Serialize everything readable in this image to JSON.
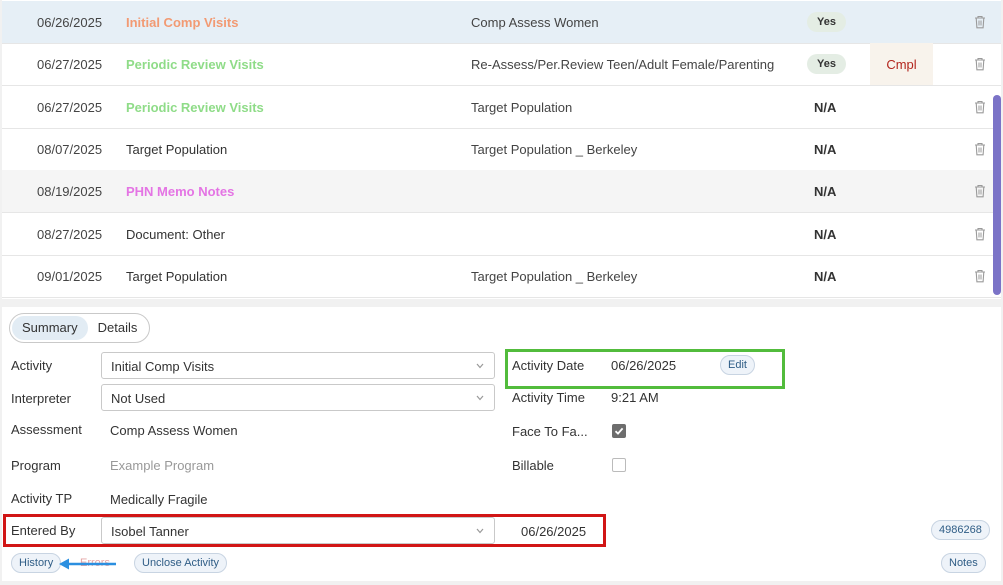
{
  "activities": [
    {
      "date": "06/26/2025",
      "name": "Initial Comp Visits",
      "name_style": "orange",
      "assessment": "Comp Assess Women",
      "status": "Yes",
      "status_type": "pill",
      "cmpl": "",
      "state": "sel"
    },
    {
      "date": "06/27/2025",
      "name": "Periodic Review Visits",
      "name_style": "green",
      "assessment": "Re-Assess/Per.Review Teen/Adult Female/Parenting",
      "status": "Yes",
      "status_type": "pill",
      "cmpl": "Cmpl",
      "state": ""
    },
    {
      "date": "06/27/2025",
      "name": "Periodic Review Visits",
      "name_style": "green",
      "assessment": "Target Population",
      "status": "N/A",
      "status_type": "text",
      "cmpl": "",
      "state": ""
    },
    {
      "date": "08/07/2025",
      "name": "Target Population",
      "name_style": "",
      "assessment": "Target Population _ Berkeley",
      "status": "N/A",
      "status_type": "text",
      "cmpl": "",
      "state": ""
    },
    {
      "date": "08/19/2025",
      "name": "PHN Memo Notes",
      "name_style": "pink",
      "assessment": "",
      "status": "N/A",
      "status_type": "text",
      "cmpl": "",
      "state": "alt"
    },
    {
      "date": "08/27/2025",
      "name": "Document: Other",
      "name_style": "",
      "assessment": "",
      "status": "N/A",
      "status_type": "text",
      "cmpl": "",
      "state": ""
    },
    {
      "date": "09/01/2025",
      "name": "Target Population",
      "name_style": "",
      "assessment": "Target Population _ Berkeley",
      "status": "N/A",
      "status_type": "text",
      "cmpl": "",
      "state": ""
    }
  ],
  "tabs": {
    "summary": "Summary",
    "details": "Details"
  },
  "form": {
    "activity_label": "Activity",
    "activity_value": "Initial Comp Visits",
    "interpreter_label": "Interpreter",
    "interpreter_value": "Not Used",
    "assessment_label": "Assessment",
    "assessment_value": "Comp Assess Women",
    "program_label": "Program",
    "program_value": "Example Program",
    "activity_tp_label": "Activity TP",
    "activity_tp_value": "Medically Fragile",
    "entered_by_label": "Entered By",
    "entered_by_value": "Isobel Tanner",
    "entered_date": "06/26/2025",
    "activity_date_label": "Activity Date",
    "activity_date_value": "06/26/2025",
    "edit_label": "Edit",
    "activity_time_label": "Activity Time",
    "activity_time_value": "9:21 AM",
    "face_to_face_label": "Face To Fa...",
    "face_to_face_checked": true,
    "billable_label": "Billable",
    "billable_checked": false
  },
  "footer": {
    "history": "History",
    "errors": "Errors",
    "unclose": "Unclose Activity",
    "record_id": "4986268",
    "notes": "Notes"
  },
  "colors": {
    "highlight_green": "#52bc3c",
    "highlight_red": "#d11515",
    "arrow_blue": "#2b8fe0",
    "scrollbar": "#7b73c7"
  }
}
